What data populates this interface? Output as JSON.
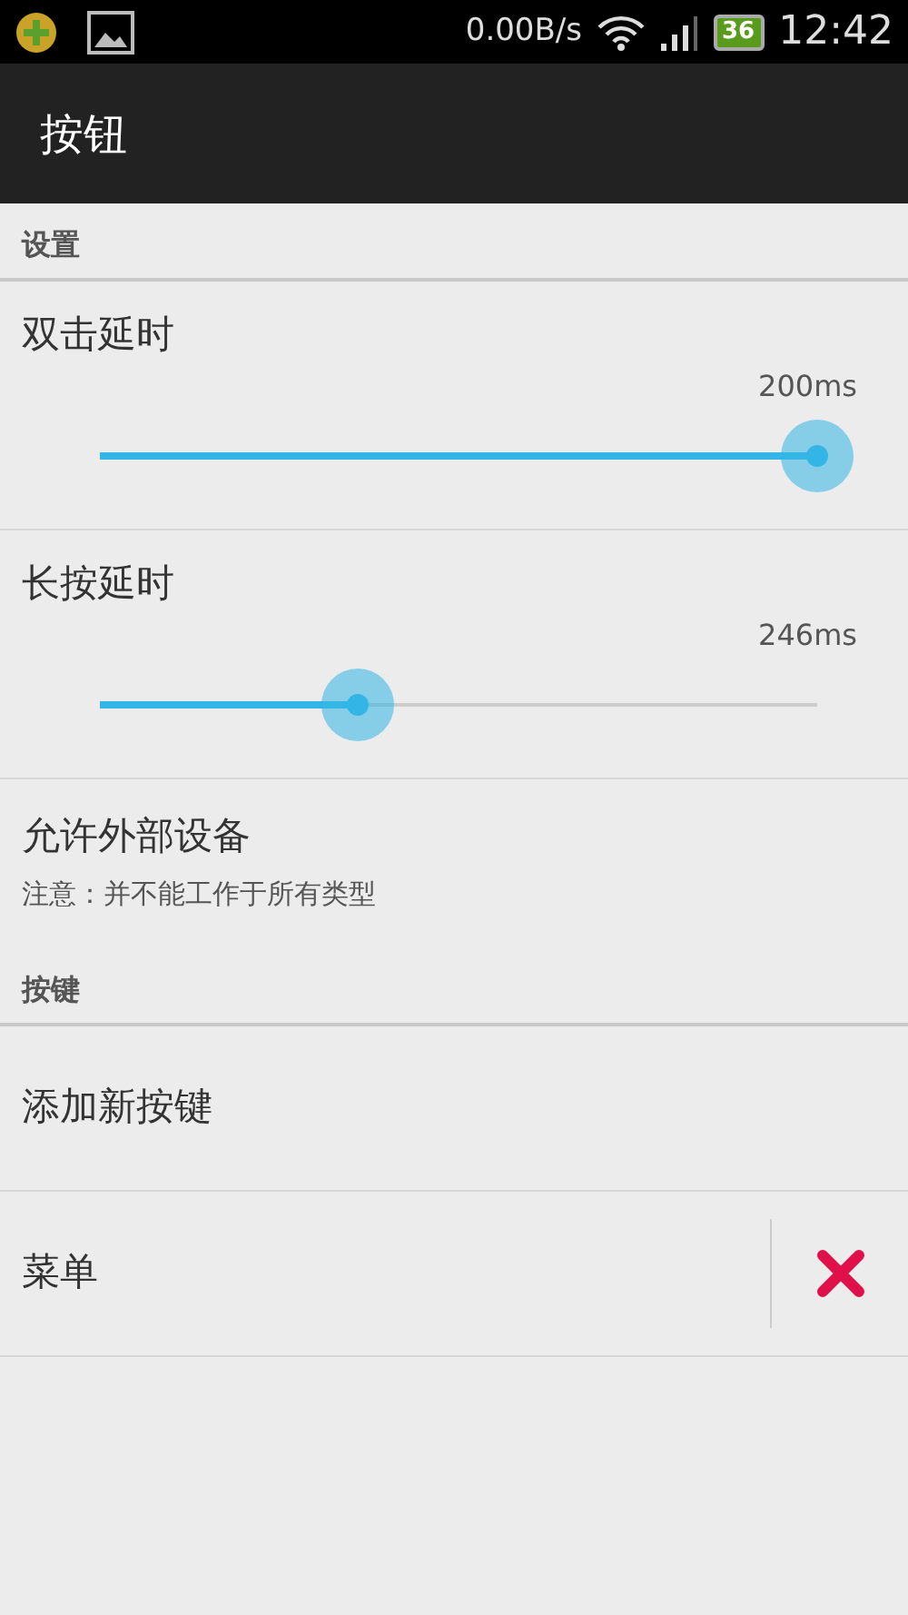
{
  "status_bar": {
    "speed": "0.00B/s",
    "battery": "36",
    "time": "12:42"
  },
  "app_bar": {
    "title": "按钮"
  },
  "sections": [
    {
      "header": "设置",
      "items": [
        {
          "kind": "slider",
          "title": "双击延时",
          "reading": "200ms",
          "level": 1.0
        },
        {
          "kind": "slider",
          "title": "长按延时",
          "reading": "246ms",
          "level": 0.36
        },
        {
          "kind": "text",
          "title": "允许外部设备",
          "summary": "注意：并不能工作于所有类型"
        }
      ]
    },
    {
      "header": "按键",
      "items": [
        {
          "kind": "action",
          "title": "添加新按键"
        },
        {
          "kind": "deletable",
          "title": "菜单"
        }
      ]
    }
  ]
}
